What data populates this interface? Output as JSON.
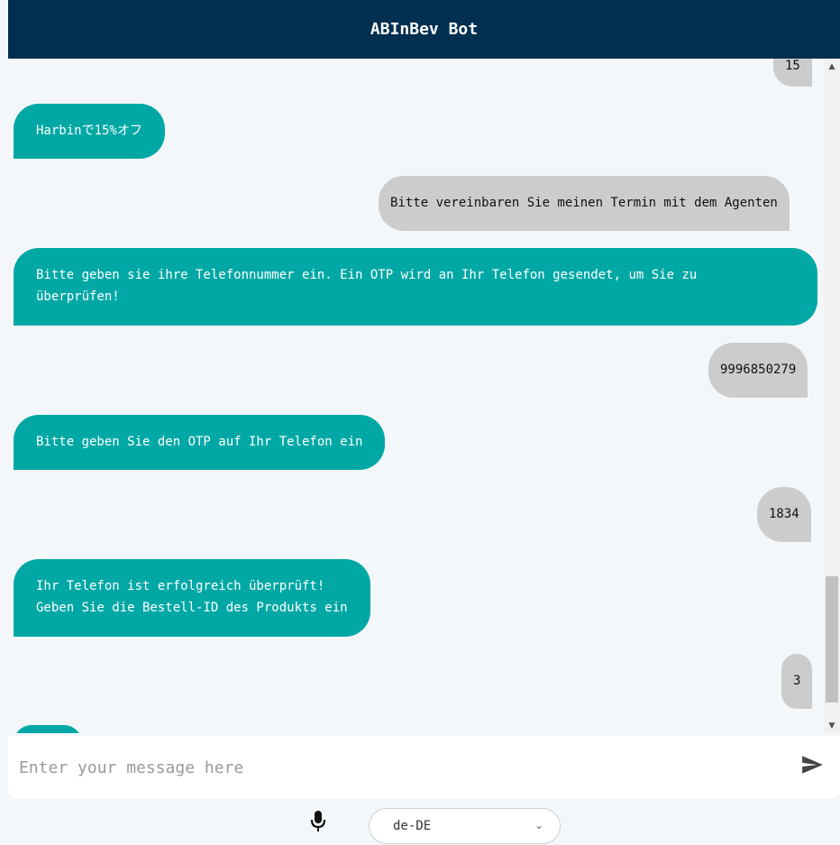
{
  "header": {
    "title": "ABInBev Bot"
  },
  "messages": [
    {
      "from": "user",
      "text": "15"
    },
    {
      "from": "bot",
      "text": "Harbinで15%オフ"
    },
    {
      "from": "user",
      "text": "Bitte vereinbaren Sie meinen Termin mit dem Agenten"
    },
    {
      "from": "bot",
      "line1": "Bitte geben sie ihre Telefonnummer ein. Ein OTP wird an Ihr Telefon gesendet, um Sie zu",
      "line2": "überprüfen!"
    },
    {
      "from": "user",
      "text": "9996850279"
    },
    {
      "from": "bot",
      "text": "Bitte geben Sie den OTP auf Ihr Telefon ein"
    },
    {
      "from": "user",
      "text": "1834"
    },
    {
      "from": "bot",
      "line1": "Ihr Telefon ist erfolgreich überprüft!",
      "line2": "Geben Sie die Bestell-ID des Produkts ein"
    },
    {
      "from": "user",
      "text": "3"
    },
    {
      "from": "bot",
      "text": ""
    }
  ],
  "input": {
    "placeholder": "Enter your message here"
  },
  "language": {
    "selected": "de-DE"
  },
  "icons": {
    "send": "send-icon",
    "mic": "microphone-icon",
    "caret": "chevron-down-icon"
  },
  "colors": {
    "header": "#012f4f",
    "bot_bubble": "#00a8a5",
    "user_bubble": "#cccccc",
    "background": "#f4f7fa"
  }
}
